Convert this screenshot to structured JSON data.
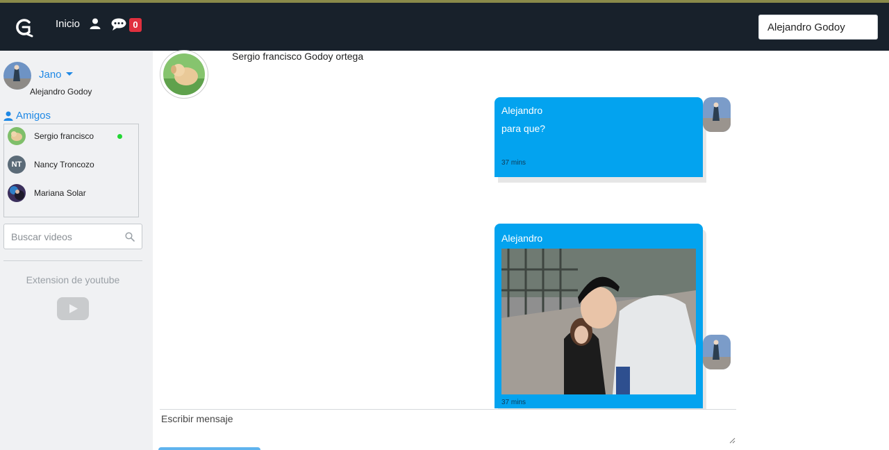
{
  "nav": {
    "home_label": "Inicio",
    "notification_count": "0",
    "search_value": "Alejandro Godoy"
  },
  "sidebar": {
    "me": {
      "nick": "Jano",
      "name": "Alejandro Godoy"
    },
    "friends_title": "Amigos",
    "friends": [
      {
        "name": "Sergio francisco",
        "online": true
      },
      {
        "name": "Nancy Troncozo",
        "initials": "NT",
        "online": false
      },
      {
        "name": "Mariana Solar",
        "online": false
      }
    ],
    "video_search_placeholder": "Buscar videos",
    "youtube_label": "Extension de youtube"
  },
  "chat": {
    "contact_name": "Sergio francisco Godoy ortega",
    "messages": [
      {
        "sender": "Alejandro",
        "text": "para que?",
        "time": "37 mins"
      },
      {
        "sender": "Alejandro",
        "attachment": "photo",
        "time": "37 mins"
      }
    ],
    "composer_placeholder": "Escribir mensaje"
  },
  "colors": {
    "navbar": "#18212b",
    "accent": "#1e88e5",
    "bubble": "#03a3ef",
    "badge": "#e0303e",
    "online": "#22d633"
  }
}
